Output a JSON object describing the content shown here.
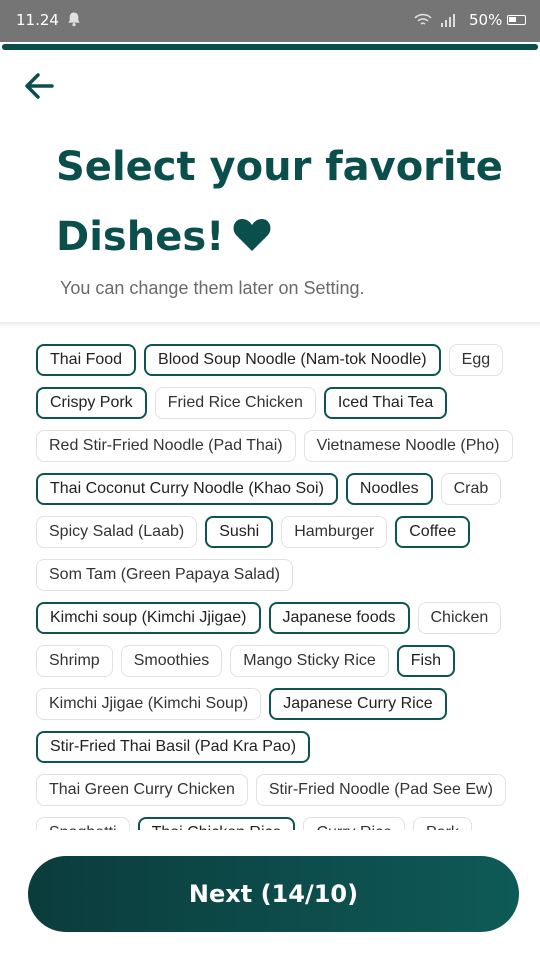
{
  "status_bar": {
    "time": "11.24",
    "battery": "50%"
  },
  "progress": {
    "fraction": 1.0
  },
  "header": {
    "title_line1": "Select your favorite",
    "title_line2": "Dishes!",
    "subtitle": "You can change them later on Setting."
  },
  "colors": {
    "accent": "#0a4f4b",
    "chip_border": "#e1e1e1"
  },
  "dishes": [
    {
      "label": "Thai Food",
      "selected": true
    },
    {
      "label": "Blood Soup Noodle (Nam-tok Noodle)",
      "selected": true
    },
    {
      "label": "Egg",
      "selected": false
    },
    {
      "label": "Crispy Pork",
      "selected": true
    },
    {
      "label": "Fried Rice Chicken",
      "selected": false
    },
    {
      "label": "Iced Thai Tea",
      "selected": true
    },
    {
      "label": "Red Stir-Fried Noodle (Pad Thai)",
      "selected": false
    },
    {
      "label": "Vietnamese Noodle (Pho)",
      "selected": false
    },
    {
      "label": "Thai Coconut Curry Noodle (Khao Soi)",
      "selected": true
    },
    {
      "label": "Noodles",
      "selected": true
    },
    {
      "label": "Crab",
      "selected": false
    },
    {
      "label": "Spicy Salad (Laab)",
      "selected": false
    },
    {
      "label": "Sushi",
      "selected": true
    },
    {
      "label": "Hamburger",
      "selected": false
    },
    {
      "label": "Coffee",
      "selected": true
    },
    {
      "label": "Som Tam (Green Papaya Salad)",
      "selected": false
    },
    {
      "label": "Kimchi soup (Kimchi Jjigae)",
      "selected": true
    },
    {
      "label": "Japanese foods",
      "selected": true
    },
    {
      "label": "Chicken",
      "selected": false
    },
    {
      "label": "Shrimp",
      "selected": false
    },
    {
      "label": "Smoothies",
      "selected": false
    },
    {
      "label": "Mango Sticky Rice",
      "selected": false
    },
    {
      "label": "Fish",
      "selected": true
    },
    {
      "label": "Kimchi Jjigae (Kimchi Soup)",
      "selected": false
    },
    {
      "label": "Japanese Curry Rice",
      "selected": true
    },
    {
      "label": "Stir-Fried Thai Basil (Pad Kra Pao)",
      "selected": true
    },
    {
      "label": "Thai Green Curry Chicken",
      "selected": false
    },
    {
      "label": "Stir-Fried Noodle (Pad See Ew)",
      "selected": false
    },
    {
      "label": "Spaghetti",
      "selected": false
    },
    {
      "label": "Thai Chicken Rice",
      "selected": true
    },
    {
      "label": "Curry Rice",
      "selected": false
    },
    {
      "label": "Pork",
      "selected": false
    }
  ],
  "footer": {
    "next_label": "Next (14/10)"
  }
}
